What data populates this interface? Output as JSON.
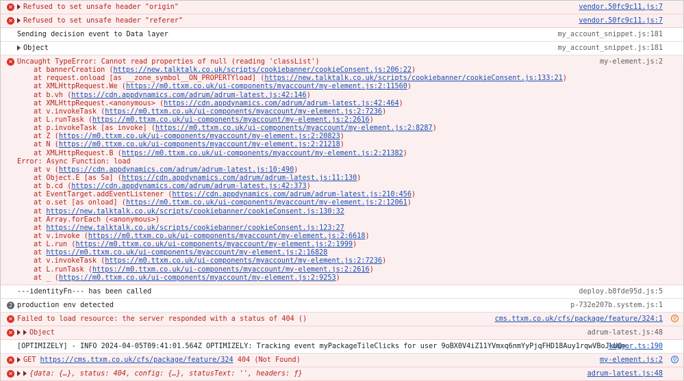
{
  "messages": [
    {
      "type": "error",
      "expandable": true,
      "text": "Refused to set unsafe header \"origin\"",
      "source": "vendor.50fc9c11.js:7",
      "source_link": true
    },
    {
      "type": "error",
      "expandable": true,
      "text": "Refused to set unsafe header \"referer\"",
      "source": "vendor.50fc9c11.js:7",
      "source_link": true
    },
    {
      "type": "info",
      "text": "Sending decision event to Data layer",
      "source": "my_account_snippet.js:181"
    },
    {
      "type": "info",
      "expandable": true,
      "text": "Object",
      "source": "my_account_snippet.js:181"
    }
  ],
  "uncaught": {
    "title": "Uncaught TypeError: Cannot read properties of null (reading 'classList')",
    "source": "my-element.js:2",
    "frames": [
      {
        "prefix": "at bannerCreation (",
        "url": "https://new.talktalk.co.uk/scripts/cookiebanner/cookieConsent.js:206:22",
        "suffix": ")"
      },
      {
        "prefix": "at request.onload [as __zone_symbol__ON_PROPERTYload] (",
        "url": "https://new.talktalk.co.uk/scripts/cookiebanner/cookieConsent.js:133:21",
        "suffix": ")"
      },
      {
        "prefix": "at XMLHttpRequest.We (",
        "url": "https://m0.ttxm.co.uk/ui-components/myaccount/my-element.js:2:11560",
        "suffix": ")"
      },
      {
        "prefix": "at b.vh (",
        "url": "https://cdn.appdynamics.com/adrum/adrum-latest.js:42:146",
        "suffix": ")"
      },
      {
        "prefix": "at XMLHttpRequest.<anonymous> (",
        "url": "https://cdn.appdynamics.com/adrum/adrum-latest.js:42:464",
        "suffix": ")"
      },
      {
        "prefix": "at v.invokeTask (",
        "url": "https://m0.ttxm.co.uk/ui-components/myaccount/my-element.js:2:7236",
        "suffix": ")"
      },
      {
        "prefix": "at L.runTask (",
        "url": "https://m0.ttxm.co.uk/ui-components/myaccount/my-element.js:2:2616",
        "suffix": ")"
      },
      {
        "prefix": "at p.invokeTask [as invoke] (",
        "url": "https://m0.ttxm.co.uk/ui-components/myaccount/my-element.js:2:8287",
        "suffix": ")"
      },
      {
        "prefix": "at Z (",
        "url": "https://m0.ttxm.co.uk/ui-components/myaccount/my-element.js:2:20823",
        "suffix": ")"
      },
      {
        "prefix": "at N (",
        "url": "https://m0.ttxm.co.uk/ui-components/myaccount/my-element.js:2:21218",
        "suffix": ")"
      },
      {
        "prefix": "at XMLHttpRequest.B (",
        "url": "https://m0.ttxm.co.uk/ui-components/myaccount/my-element.js:2:21382",
        "suffix": ")"
      }
    ],
    "async_header": "Error: Async Function: load",
    "async_frames": [
      {
        "prefix": "at v (",
        "url": "https://cdn.appdynamics.com/adrum/adrum-latest.js:10:490",
        "suffix": ")"
      },
      {
        "prefix": "at Object.E [as Sa] (",
        "url": "https://cdn.appdynamics.com/adrum/adrum-latest.js:11:130",
        "suffix": ")"
      },
      {
        "prefix": "at b.cd (",
        "url": "https://cdn.appdynamics.com/adrum/adrum-latest.js:42:373",
        "suffix": ")"
      },
      {
        "prefix": "at EventTarget.addEventListener (",
        "url": "https://cdn.appdynamics.com/adrum/adrum-latest.js:210:456",
        "suffix": ")"
      },
      {
        "prefix": "at o.set [as onload] (",
        "url": "https://m0.ttxm.co.uk/ui-components/myaccount/my-element.js:2:12061",
        "suffix": ")"
      },
      {
        "prefix": "at ",
        "url": "https://new.talktalk.co.uk/scripts/cookiebanner/cookieConsent.js:130:32",
        "suffix": ""
      },
      {
        "prefix": "at Array.forEach (<anonymous>)",
        "url": "",
        "suffix": ""
      },
      {
        "prefix": "at ",
        "url": "https://new.talktalk.co.uk/scripts/cookiebanner/cookieConsent.js:123:27",
        "suffix": ""
      },
      {
        "prefix": "at v.invoke (",
        "url": "https://m0.ttxm.co.uk/ui-components/myaccount/my-element.js:2:6618",
        "suffix": ")"
      },
      {
        "prefix": "at L.run (",
        "url": "https://m0.ttxm.co.uk/ui-components/myaccount/my-element.js:2:1999",
        "suffix": ")"
      },
      {
        "prefix": "at ",
        "url": "https://m0.ttxm.co.uk/ui-components/myaccount/my-element.js:2:16828",
        "suffix": ""
      },
      {
        "prefix": "at v.invokeTask (",
        "url": "https://m0.ttxm.co.uk/ui-components/myaccount/my-element.js:2:7236",
        "suffix": ")"
      },
      {
        "prefix": "at L.runTask (",
        "url": "https://m0.ttxm.co.uk/ui-components/myaccount/my-element.js:2:2616",
        "suffix": ")"
      },
      {
        "prefix": "at _ (",
        "url": "https://m0.ttxm.co.uk/ui-components/myaccount/my-element.js:2:9253",
        "suffix": ")"
      }
    ]
  },
  "after": [
    {
      "type": "info",
      "text": "---identityFn--- has been called",
      "source": "deploy.b8fde95d.js:5"
    },
    {
      "type": "info",
      "badge": "2",
      "text": "production env detected",
      "source": "p-732e207b.system.js:1"
    },
    {
      "type": "error",
      "text": "Failed to load resource: the server responded with a status of 404 ()",
      "source": "cms.ttxm.co.uk/cfs/package/feature/324:1",
      "source_link": true,
      "net_icon": "orange"
    },
    {
      "type": "error",
      "double_expand": true,
      "text": "Object",
      "source": "adrum-latest.js:48"
    },
    {
      "type": "info",
      "text": "[OPTIMIZELY] - INFO  2024-04-05T09:41:01.564Z OPTIMIZELY: Tracking event myPackageTileClicks for user 9oBX0V4iZ11YVmxq6nmYyPjqFHD18Auy1rqwVBoJkUQ=.",
      "source": "logger.ts:190",
      "source_link": true
    }
  ],
  "get_row": {
    "method": "GET",
    "url": "https://cms.ttxm.co.uk/cfs/package/feature/324",
    "status": "404 (Not Found)",
    "source": "my-element.js:2",
    "net_icon": "blue"
  },
  "last_row": {
    "text": "{data: {…}, status: 404, config: {…}, statusText: '', headers: ƒ}",
    "source": "adrum-latest.js:48"
  },
  "icons": {
    "error": "error-circle-icon",
    "expand": "expand-triangle-icon",
    "network": "network-icon"
  },
  "colors": {
    "error_bg": "#fcefef",
    "error_text": "#c5221f",
    "link": "#1a4fb5"
  }
}
